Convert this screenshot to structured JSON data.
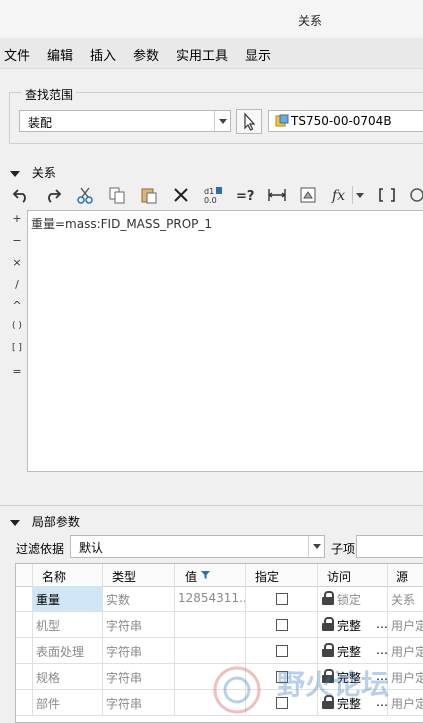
{
  "window": {
    "title": "关系"
  },
  "menu": [
    "文件",
    "编辑",
    "插入",
    "参数",
    "实用工具",
    "显示"
  ],
  "search": {
    "legend": "查找范围",
    "scope_value": "装配",
    "model_value": "TS750-00-0704B"
  },
  "relations": {
    "header": "关系",
    "toolbar": [
      "undo-icon",
      "redo-icon",
      "cut-icon",
      "copy-icon",
      "paste-icon",
      "delete-icon",
      "switch-dims-icon",
      "evaluate-icon",
      "measure-icon",
      "properties-icon",
      "function-icon",
      "dropdown-icon",
      "brackets-icon",
      "verify-icon"
    ],
    "operators": [
      "+",
      "−",
      "×",
      "/",
      "^",
      "( )",
      "[ ]",
      "="
    ],
    "text": "重量=mass:FID_MASS_PROP_1"
  },
  "local_params": {
    "header": "局部参数",
    "filter_label": "过滤依据",
    "filter_value": "默认",
    "subitem_label": "子项",
    "columns": [
      "名称",
      "类型",
      "值",
      "指定",
      "访问",
      "源"
    ],
    "rows": [
      {
        "name": "重量",
        "type": "实数",
        "value": "12854311...",
        "access": "锁定",
        "source": "关系",
        "selected": true
      },
      {
        "name": "机型",
        "type": "字符串",
        "value": "",
        "access": "完整",
        "source": "用户定",
        "selected": false
      },
      {
        "name": "表面处理",
        "type": "字符串",
        "value": "",
        "access": "完整",
        "source": "用户定",
        "selected": false
      },
      {
        "name": "规格",
        "type": "字符串",
        "value": "",
        "access": "完整",
        "source": "用户定",
        "selected": false
      },
      {
        "name": "部件",
        "type": "字符串",
        "value": "",
        "access": "完整",
        "source": "用户定",
        "selected": false
      }
    ]
  },
  "watermark": "野火论坛",
  "colors": {
    "selected_row": "#cfe6f7",
    "background": "#f0f0f0"
  }
}
